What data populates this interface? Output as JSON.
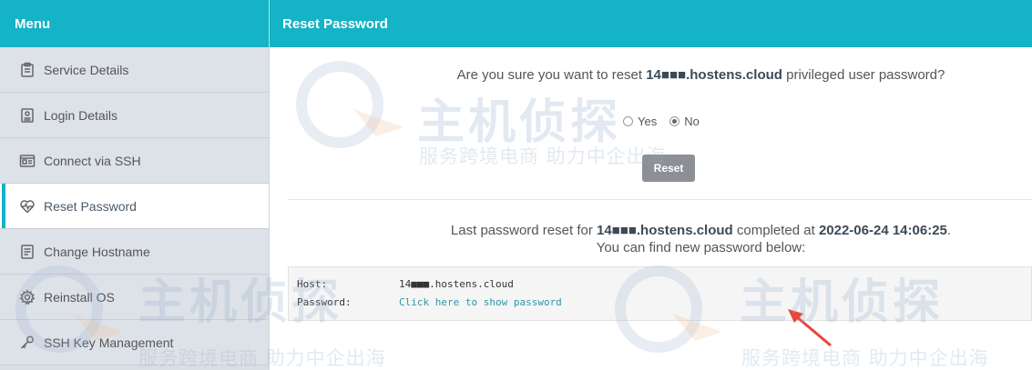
{
  "sidebar": {
    "title": "Menu",
    "items": [
      {
        "label": "Service Details",
        "icon": "clipboard-icon"
      },
      {
        "label": "Login Details",
        "icon": "id-card-icon"
      },
      {
        "label": "Connect via SSH",
        "icon": "terminal-icon"
      },
      {
        "label": "Reset Password",
        "icon": "heartbeat-icon",
        "active": true
      },
      {
        "label": "Change Hostname",
        "icon": "document-icon"
      },
      {
        "label": "Reinstall OS",
        "icon": "gear-icon"
      },
      {
        "label": "SSH Key Management",
        "icon": "key-icon"
      }
    ]
  },
  "main": {
    "title": "Reset Password",
    "question": {
      "prefix": "Are you sure you want to reset ",
      "host": "14■■■.hostens.cloud",
      "suffix": " privileged user password?"
    },
    "radios": [
      {
        "label": "Yes",
        "checked": false
      },
      {
        "label": "No",
        "checked": true
      }
    ],
    "reset_label": "Reset",
    "last_reset": {
      "prefix": "Last password reset for ",
      "host": "14■■■.hostens.cloud",
      "middle": " completed at ",
      "datetime": "2022-06-24 14:06:25",
      "end": ".",
      "line2": "You can find new password below:"
    },
    "credentials": {
      "host_key": "Host:",
      "host_value": "14■■■.hostens.cloud",
      "password_key": "Password:",
      "password_link": "Click here to show password"
    }
  },
  "watermark": {
    "big": "主机侦探",
    "small": "服务跨境电商 助力中企出海"
  },
  "colors": {
    "accent": "#14b3c6",
    "button": "#8c8f96",
    "link": "#2a9aa8",
    "arrow": "#e8463c"
  }
}
